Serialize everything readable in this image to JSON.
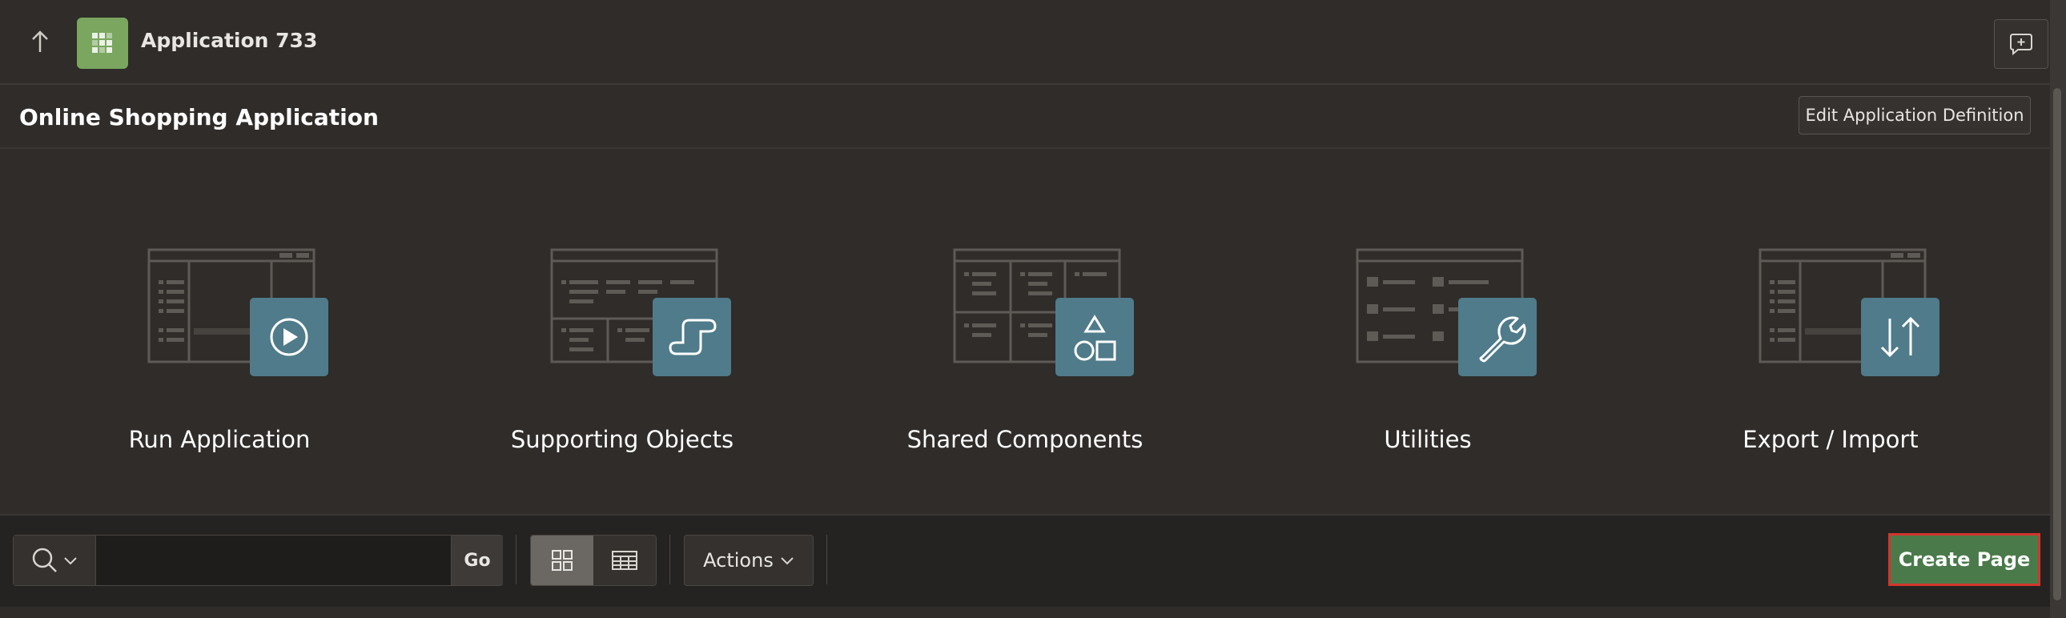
{
  "app": {
    "title": "Application 733"
  },
  "page": {
    "title": "Online Shopping Application"
  },
  "header": {
    "edit_label": "Edit Application Definition"
  },
  "tiles": [
    {
      "label": "Run Application",
      "icon": "play-icon"
    },
    {
      "label": "Supporting Objects",
      "icon": "scroll-icon"
    },
    {
      "label": "Shared Components",
      "icon": "shapes-icon"
    },
    {
      "label": "Utilities",
      "icon": "wrench-icon"
    },
    {
      "label": "Export / Import",
      "icon": "arrows-up-down-icon"
    }
  ],
  "toolbar": {
    "search_value": "",
    "go_label": "Go",
    "actions_label": "Actions",
    "create_label": "Create Page"
  },
  "colors": {
    "accent_tile": "#4f7b8a",
    "app_icon": "#7aa65f",
    "create_button": "#4a7a4a",
    "highlight_border": "#d3362d"
  }
}
